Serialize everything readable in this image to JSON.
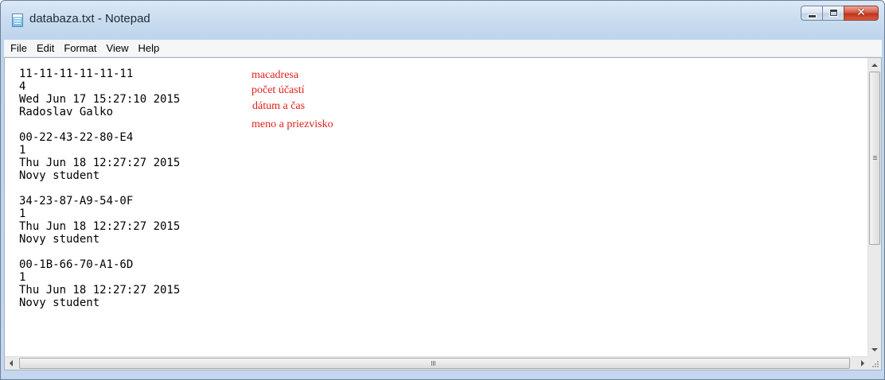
{
  "window": {
    "title": "databaza.txt - Notepad"
  },
  "menu": {
    "items": [
      "File",
      "Edit",
      "Format",
      "View",
      "Help"
    ]
  },
  "document": {
    "lines": [
      "11-11-11-11-11-11",
      "4",
      "Wed Jun 17 15:27:10 2015",
      "Radoslav Galko",
      "",
      "00-22-43-22-80-E4",
      "1",
      "Thu Jun 18 12:27:27 2015",
      "Novy student",
      "",
      "34-23-87-A9-54-0F",
      "1",
      "Thu Jun 18 12:27:27 2015",
      "Novy student",
      "",
      "00-1B-66-70-A1-6D",
      "1",
      "Thu Jun 18 12:27:27 2015",
      "Novy student"
    ]
  },
  "annotations": {
    "color": "#e0201b",
    "labels": [
      "macadresa",
      "počet účastí",
      "dátum a čas",
      "meno a priezvisko"
    ]
  },
  "icons": {
    "app": "notepad-icon",
    "minimize": "minimize-icon",
    "maximize": "maximize-icon",
    "close": "close-icon"
  }
}
